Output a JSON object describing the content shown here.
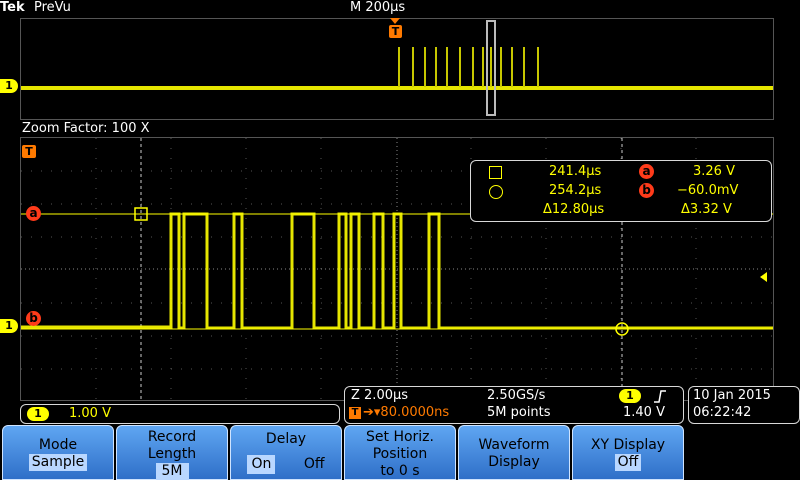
{
  "header": {
    "brand": "Tek",
    "mode": "PreVu",
    "timebase": "M 200µs"
  },
  "overview": {
    "channel_marker": "1",
    "trigger_marker": "T"
  },
  "zoom": {
    "label": "Zoom Factor: 100 X",
    "trigger_marker": "T",
    "channel_marker": "1"
  },
  "cursors": {
    "cursor_a_label": "a",
    "cursor_b_label": "b",
    "square_time": "241.4µs",
    "circle_time": "254.2µs",
    "delta_time": "Δ12.80µs",
    "a_value": "3.26 V",
    "b_value": "−60.0mV",
    "delta_value": "Δ3.32 V"
  },
  "channel_readout": {
    "channel": "1",
    "scale": "1.00 V"
  },
  "horizontal_readout": {
    "zoom_scale": "Z 2.00µs",
    "sample_rate": "2.50GS/s",
    "position_marker": "T",
    "position": "➔▾80.0000ns",
    "record": "5M points",
    "trigger_channel": "1",
    "trigger_slope_icon": "rising-edge-icon",
    "trigger_level": "1.40 V"
  },
  "datetime": {
    "date": "10 Jan  2015",
    "time": "06:22:42"
  },
  "menu": [
    {
      "label": "Mode",
      "value": "Sample"
    },
    {
      "label": "Record\nLength",
      "value": "5M"
    },
    {
      "label": "Delay",
      "on": "On",
      "off": "Off"
    },
    {
      "label": "Set Horiz.\nPosition\nto 0 s"
    },
    {
      "label": "Waveform\nDisplay"
    },
    {
      "label": "XY Display",
      "value": "Off"
    }
  ],
  "colors": {
    "trace": "#ffff00",
    "cursor_badge": "#ff3b1a",
    "menu_button": "#4a8fe0"
  }
}
